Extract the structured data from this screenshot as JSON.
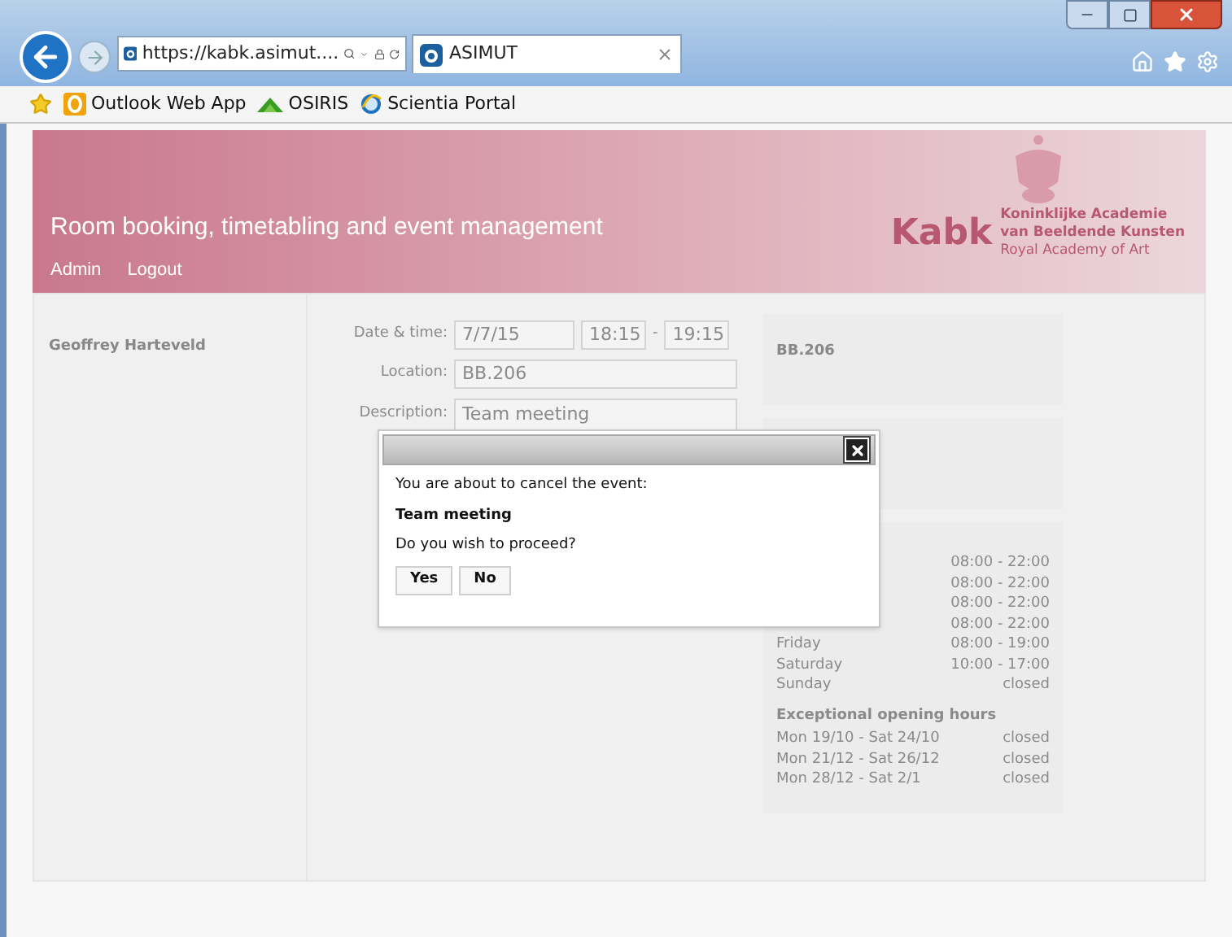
{
  "browser": {
    "address": "https://kabk.asimut....",
    "tab_title": "ASIMUT",
    "favorites": [
      {
        "kind": "outlook",
        "label": "Outlook Web App"
      },
      {
        "kind": "osiris",
        "label": "OSIRIS"
      },
      {
        "kind": "ie",
        "label": "Scientia Portal"
      }
    ]
  },
  "header": {
    "title": "Room booking, timetabling and event management",
    "links": [
      "Admin",
      "Logout"
    ],
    "logo": {
      "mark": "Kabk",
      "lines": [
        "Koninklijke Academie",
        "van Beeldende Kunsten",
        "Royal Academy of Art"
      ]
    }
  },
  "user": "Geoffrey Harteveld",
  "form": {
    "date_label": "Date & time:",
    "date": "7/7/15",
    "start": "18:15",
    "separator": "-",
    "end": "19:15",
    "location_label": "Location:",
    "location": "BB.206",
    "description_label": "Description:",
    "description": "Team meeting"
  },
  "room": {
    "name": "BB.206"
  },
  "hours": {
    "rows": [
      {
        "hours": "08:00 - 22:00"
      },
      {
        "hours": "08:00 - 22:00"
      },
      {
        "hours": "08:00 - 22:00"
      },
      {
        "hours": "08:00 - 22:00"
      },
      {
        "day": "Friday",
        "hours": "08:00 - 19:00"
      },
      {
        "day": "Saturday",
        "hours": "10:00 - 17:00"
      },
      {
        "day": "Sunday",
        "hours": "closed"
      }
    ],
    "exceptional_title": "Exceptional opening hours",
    "exceptional": [
      {
        "period": "Mon 19/10 - Sat 24/10",
        "hours": "closed"
      },
      {
        "period": "Mon 21/12 - Sat 26/12",
        "hours": "closed"
      },
      {
        "period": "Mon 28/12 - Sat 2/1",
        "hours": "closed"
      }
    ]
  },
  "dialog": {
    "message": "You are about to cancel the event:",
    "event": "Team meeting",
    "question": "Do you wish to proceed?",
    "buttons": [
      "Yes",
      "No"
    ]
  }
}
